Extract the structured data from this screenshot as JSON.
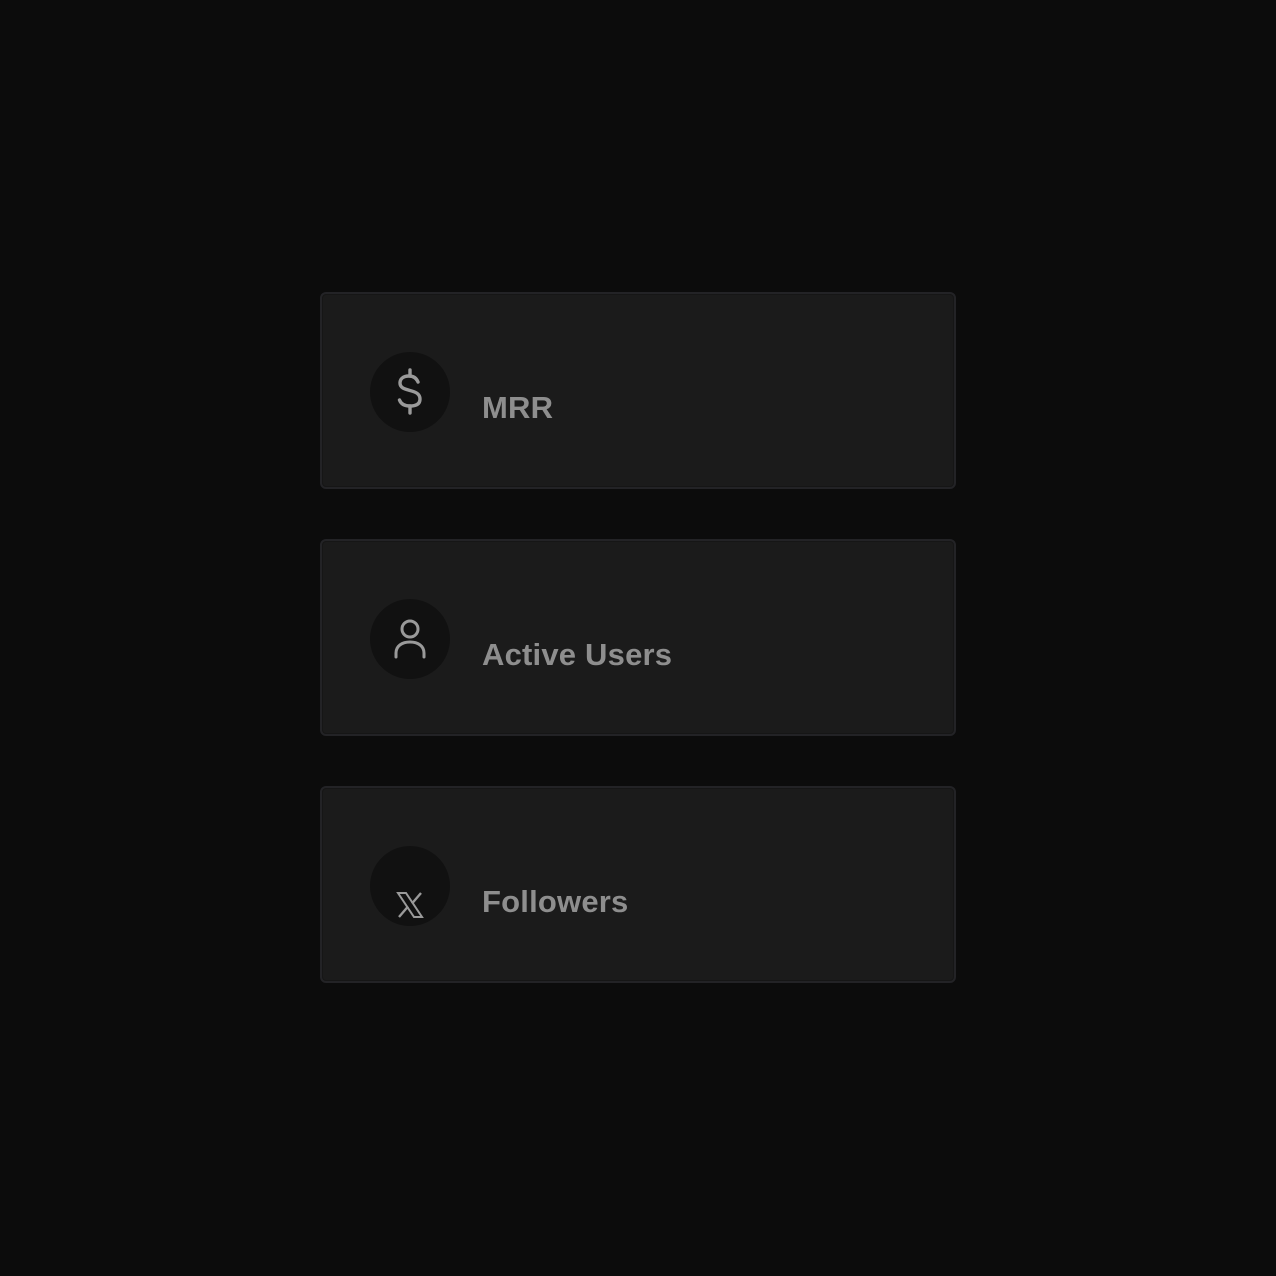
{
  "metrics": [
    {
      "label": "MRR",
      "icon": "dollar-icon"
    },
    {
      "label": "Active Users",
      "icon": "user-icon"
    },
    {
      "label": "Followers",
      "icon": "x-logo-icon"
    }
  ],
  "colors": {
    "background": "#0c0c0c",
    "card": "#1b1b1b",
    "card_border": "#232326",
    "icon_circle": "#111111",
    "text": "#8e8e8e"
  }
}
